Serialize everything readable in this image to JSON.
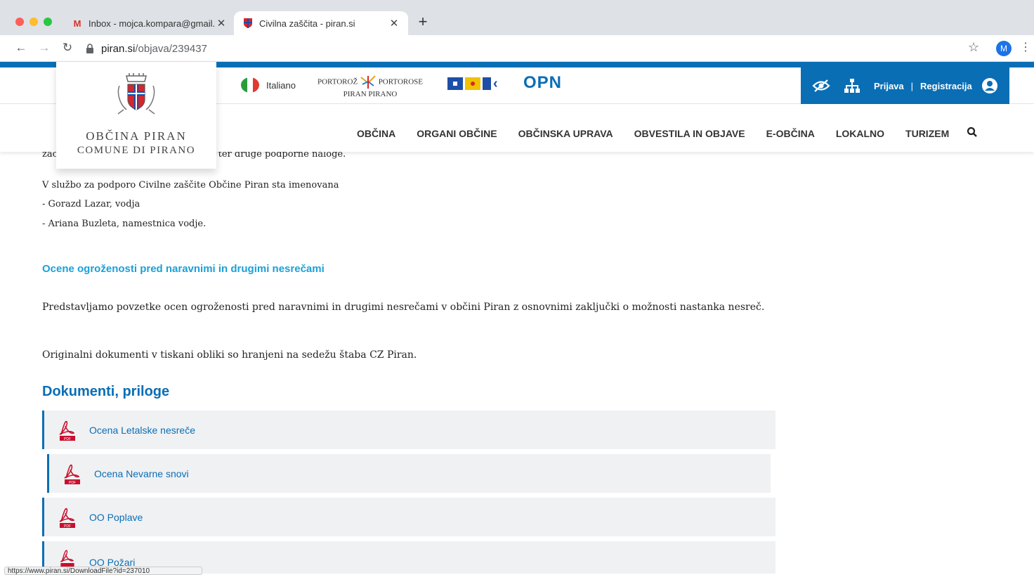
{
  "browser": {
    "tabs": [
      {
        "title": "Inbox - mojca.kompara@gmail.",
        "favicon": "gmail-icon"
      },
      {
        "title": "Civilna zaščita - piran.si",
        "favicon": "piran-crest-icon"
      }
    ],
    "url_host": "piran.si",
    "url_path": "/objava/239437",
    "profile_initial": "M",
    "status_url": "https://www.piran.si/DownloadFile?id=237010"
  },
  "header": {
    "language_label": "Italiano",
    "portoroz_line1": "PORTOROŽ",
    "portoroz_line1b": "PORTOROSE",
    "portoroz_line2": "PIRAN PIRANO",
    "opn_label": "OPN",
    "login_label": "Prijava",
    "separator": "|",
    "register_label": "Registracija",
    "accent_color": "#0a6eb5"
  },
  "logo": {
    "line1": "OBČINA PIRAN",
    "line2": "COMUNE DI PIRANO"
  },
  "menu": {
    "items": [
      "OBČINA",
      "ORGANI OBČINE",
      "OBČINSKA UPRAVA",
      "OBVESTILA IN OBJAVE",
      "E-OBČINA",
      "LOKALNO",
      "TURIZEM"
    ]
  },
  "content": {
    "cut_line_start": "zač",
    "cut_line_end": "enin ter druge podporne naloge.",
    "service_intro": "V službo za podporo Civilne zaščite Občine Piran sta imenovana",
    "member1": "- Gorazd Lazar, vodja",
    "member2": "- Ariana Buzleta, namestnica vodje.",
    "section_heading": "Ocene ogroženosti pred naravnimi in drugimi nesrečami",
    "paragraph1": "Predstavljamo povzetke ocen ogroženosti pred naravnimi in drugimi nesrečami v občini Piran z osnovnimi zaključki o možnosti nastanka nesreč.",
    "paragraph2": "Originalni dokumenti v tiskani obliki so hranjeni na sedežu štaba CZ Piran.",
    "docs_heading": "Dokumenti, priloge",
    "documents": [
      {
        "label": "Ocena Letalske nesreče"
      },
      {
        "label": "Ocena Nevarne snovi"
      },
      {
        "label": "OO Poplave"
      },
      {
        "label": "OO Požari"
      }
    ]
  }
}
